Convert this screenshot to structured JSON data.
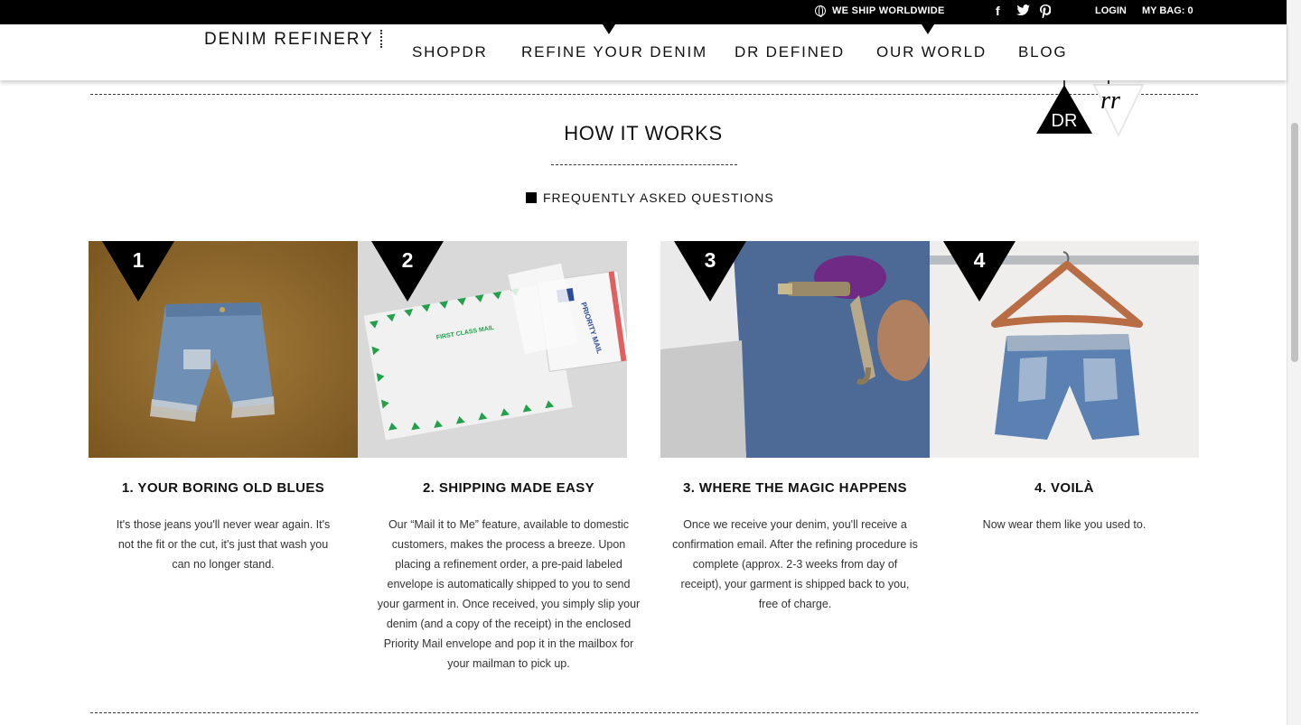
{
  "topbar": {
    "ship_label": "WE SHIP WORLDWIDE",
    "social": [
      "f",
      "t",
      "p"
    ],
    "login_label": "LOGIN",
    "bag_label": "MY BAG: 0"
  },
  "header": {
    "logo": "DENIM REFINERY",
    "nav": [
      "SHOPDR",
      "REFINE YOUR DENIM",
      "DR DEFINED",
      "OUR WORLD",
      "BLOG"
    ]
  },
  "badges": {
    "dr": "DR",
    "rr": "rr"
  },
  "section": {
    "title": "HOW IT WORKS",
    "faq_label": "FREQUENTLY ASKED QUESTIONS"
  },
  "steps": [
    {
      "num": "1",
      "title": "1. YOUR BORING OLD BLUES",
      "text": "It's those jeans you'll never wear again. It's not the fit or the cut, it's just that wash you can no longer stand."
    },
    {
      "num": "2",
      "title": "2. SHIPPING MADE EASY",
      "text": "Our “Mail it to Me” feature, available to domestic customers, makes the process a breeze. Upon placing a refinement order, a pre-paid labeled envelope is automatically shipped to you to send your garment in. Once received, you simply slip your denim (and a copy of the receipt) in the enclosed Priority Mail envelope and pop it in the mailbox for your mailman to pick up."
    },
    {
      "num": "3",
      "title": "3. WHERE THE MAGIC HAPPENS",
      "text": "Once we receive your denim, you'll receive a confirmation email. After the refining procedure is complete (approx. 2-3 weeks from day of receipt), your garment is shipped back to you, free of charge."
    },
    {
      "num": "4",
      "title": "4. VOILÀ",
      "text": "Now wear them like you used to."
    }
  ],
  "envelope_labels": {
    "first_class": "FIRST CLASS MAIL",
    "priority": "PRIORITY MAIL"
  }
}
